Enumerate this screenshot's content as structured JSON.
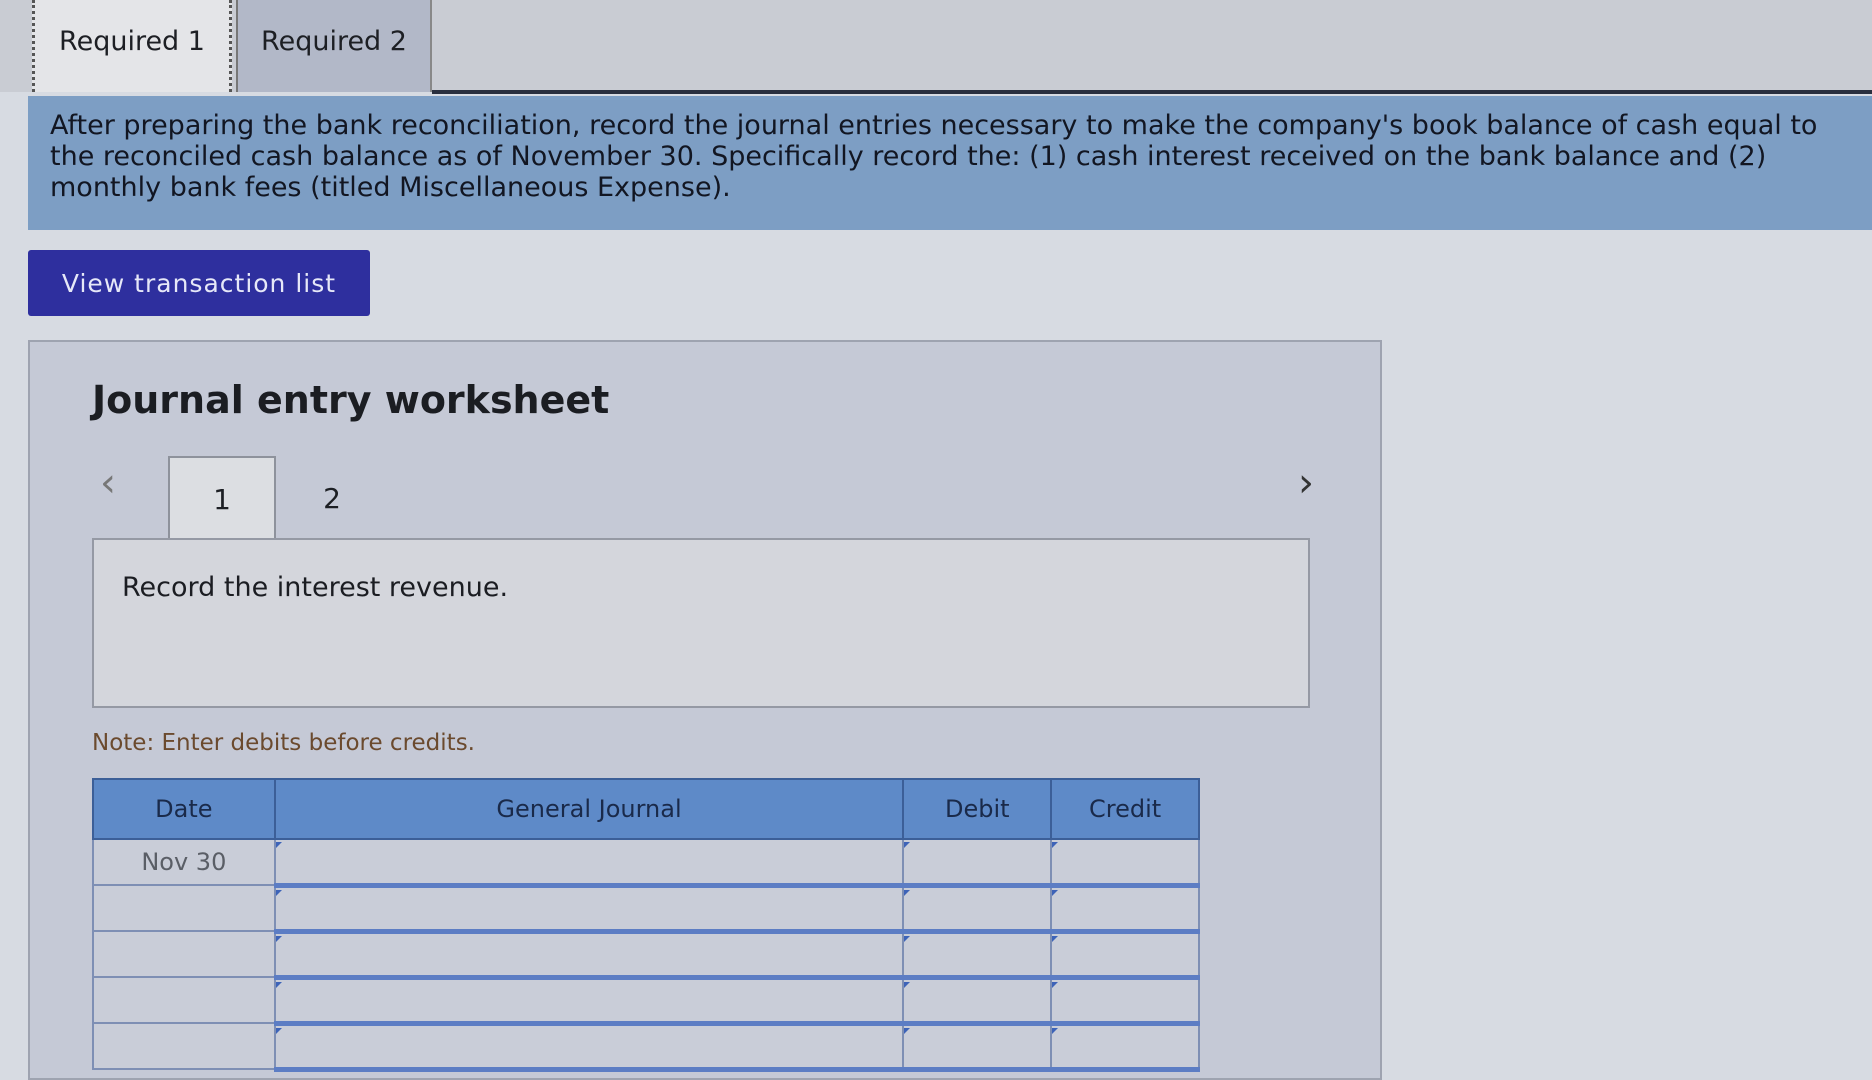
{
  "tabs": [
    {
      "label": "Required 1"
    },
    {
      "label": "Required 2"
    }
  ],
  "instruction": "After preparing the bank reconciliation, record the journal entries necessary to make the company's book balance of cash equal to the reconciled cash balance as of November 30. Specifically record the: (1) cash interest received on the bank balance and (2) monthly bank fees (titled Miscellaneous Expense).",
  "view_button": "View transaction list",
  "worksheet": {
    "title": "Journal entry worksheet",
    "steps": [
      "1",
      "2"
    ],
    "prev_icon": "‹",
    "next_icon": "›",
    "task": "Record the interest revenue.",
    "note": "Note: Enter debits before credits."
  },
  "table": {
    "headers": {
      "date": "Date",
      "account": "General Journal",
      "debit": "Debit",
      "credit": "Credit"
    },
    "rows": [
      {
        "date": "Nov 30",
        "account": "",
        "debit": "",
        "credit": ""
      },
      {
        "date": "",
        "account": "",
        "debit": "",
        "credit": ""
      },
      {
        "date": "",
        "account": "",
        "debit": "",
        "credit": ""
      },
      {
        "date": "",
        "account": "",
        "debit": "",
        "credit": ""
      },
      {
        "date": "",
        "account": "",
        "debit": "",
        "credit": ""
      }
    ]
  },
  "colors": {
    "banner": "#7d9ec4",
    "button": "#2e2f9e",
    "table_header": "#5e8ac8"
  }
}
